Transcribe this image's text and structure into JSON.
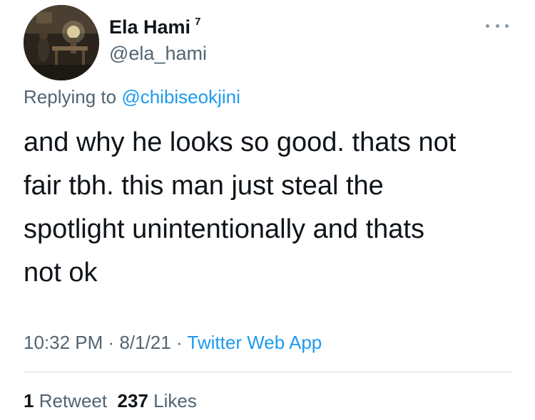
{
  "author": {
    "display_name": "Ela Hami",
    "name_suffix": "7",
    "handle": "@ela_hami"
  },
  "icons": {
    "avatar": "profile-photo",
    "more": "more-options-icon"
  },
  "reply": {
    "prefix": "Replying to",
    "mention": "@chibiseokjini"
  },
  "tweet": {
    "lines": [
      "and why he looks so good. thats not",
      "fair tbh. this man just steal the",
      "spotlight unintentionally and thats",
      "not ok"
    ]
  },
  "meta": {
    "time": "10:32 PM",
    "sep1": "·",
    "date": "8/1/21",
    "sep2": "·",
    "source": "Twitter Web App"
  },
  "stats": {
    "retweets_count": "1",
    "retweets_label": "Retweet",
    "likes_count": "237",
    "likes_label": "Likes"
  },
  "colors": {
    "text": "#0f1419",
    "secondary": "#536471",
    "link": "#1d9bf0",
    "divider": "#d9dcdf"
  }
}
